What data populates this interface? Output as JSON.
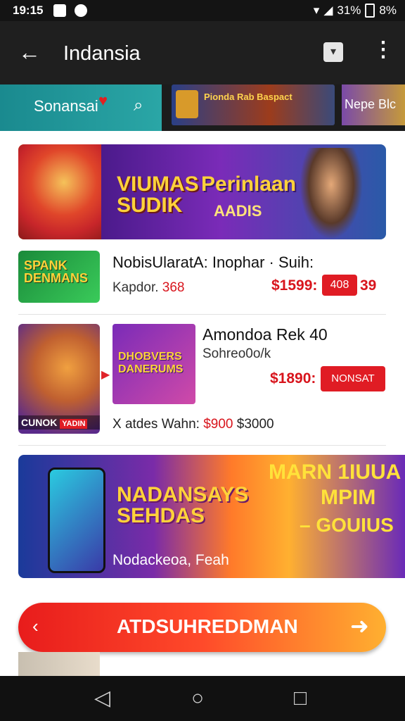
{
  "status_bar": {
    "time": "19:15",
    "battery_a": "31%",
    "battery_b": "8%"
  },
  "app_bar": {
    "back_icon": "←",
    "title": "Indansia",
    "more_icon": "⋮"
  },
  "search": {
    "label": "Sonansai",
    "icon": "🔍"
  },
  "promo_tiles": [
    {
      "text": "Pionda Rab Baspact"
    },
    {
      "text": "Nepe Blc"
    }
  ],
  "banner1": {
    "line1": "VIUMAS",
    "line2": "SUDIK",
    "line3": "Perinlaan",
    "line4": "AADIS"
  },
  "items": [
    {
      "thumb_text": "SPANK DENMANS",
      "name": "NobisUlaratA: Inophar · Suih:",
      "sub_label": "Kapdor.",
      "sub_value": "368",
      "price": "$1599:",
      "button": "408",
      "extra": "39"
    },
    {
      "thumb_text": "CUNOK",
      "thumb_badge": "YADIN",
      "game_text": "DHOBVERS DANERUMS",
      "name": "Amondoa Rek 40",
      "sub": "Sohreo0o/k",
      "price": "$1890:",
      "button": "NONSAT",
      "meta_label": "X atdes Wahn:",
      "meta_value": "$900",
      "meta_extra": "$3000"
    }
  ],
  "banner2": {
    "title1": "NADANSAYS",
    "title2": "SEHDAS",
    "caption": "Nodackeoa, Feah",
    "right1": "MARN 1IUUA",
    "right2": "MPIM",
    "right3": "– GOUIUS"
  },
  "cta": {
    "chevron": "‹",
    "label": "ATDSUHREDDMAN",
    "arrow": "➜"
  },
  "nav": {
    "back": "◁",
    "home": "○",
    "recents": "□"
  }
}
